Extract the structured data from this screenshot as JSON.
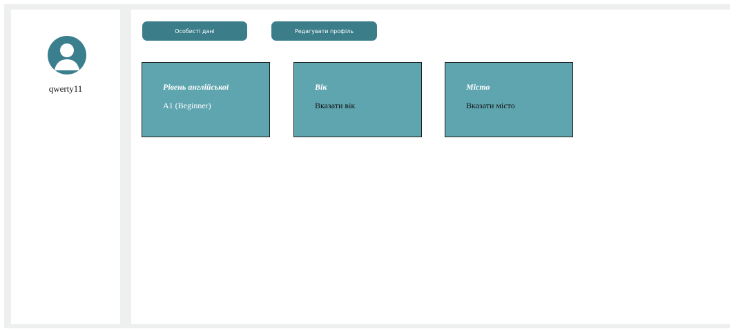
{
  "sidebar": {
    "username": "qwerty11",
    "avatar_icon": "user-avatar-icon"
  },
  "toolbar": {
    "personal_data_label": "Особисті дані",
    "edit_profile_label": "Редагувати профіль"
  },
  "cards": {
    "english": {
      "title": "Рівень англійської",
      "value": "A1 (Beginner)"
    },
    "age": {
      "title": "Вік",
      "value": "Вказати вік"
    },
    "city": {
      "title": "Місто",
      "value": "Вказати місто"
    }
  },
  "colors": {
    "accent": "#3b7e8a",
    "card": "#5fa5b0",
    "frame": "#eef0f0"
  }
}
